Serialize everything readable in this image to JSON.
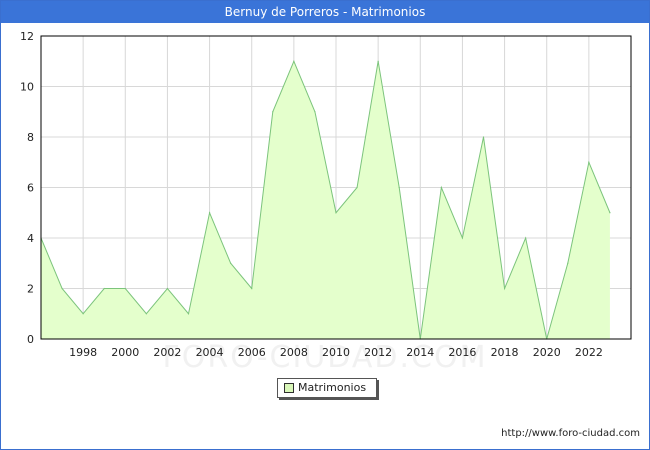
{
  "window": {
    "title": "Bernuy de Porreros - Matrimonios"
  },
  "watermark": "FORO-CIUDAD.COM",
  "source": "http://www.foro-ciudad.com",
  "colors": {
    "title_bar": "#3a74d8",
    "area_fill": "#e4ffcc",
    "line": "#7cc47c",
    "grid": "#d8d8d8",
    "swatch": "#d9f7b9"
  },
  "chart_data": {
    "type": "area",
    "title": "Bernuy de Porreros - Matrimonios",
    "xlabel": "",
    "ylabel": "",
    "ylim": [
      0,
      12
    ],
    "xlim": [
      1996,
      2024
    ],
    "grid": true,
    "legend_position": "bottom-center",
    "yticks": [
      "0",
      "2",
      "4",
      "6",
      "8",
      "10",
      "12"
    ],
    "xticks": [
      "1998",
      "2000",
      "2002",
      "2004",
      "2006",
      "2008",
      "2010",
      "2012",
      "2014",
      "2016",
      "2018",
      "2020",
      "2022"
    ],
    "x": [
      1996,
      1997,
      1998,
      1999,
      2000,
      2001,
      2002,
      2003,
      2004,
      2005,
      2006,
      2007,
      2008,
      2009,
      2010,
      2011,
      2012,
      2013,
      2014,
      2015,
      2016,
      2017,
      2018,
      2019,
      2020,
      2021,
      2022,
      2023
    ],
    "series": [
      {
        "name": "Matrimonios",
        "values": [
          4,
          2,
          1,
          2,
          2,
          1,
          2,
          1,
          5,
          3,
          2,
          9,
          11,
          9,
          5,
          6,
          11,
          6,
          0,
          6,
          4,
          8,
          2,
          4,
          0,
          3,
          7,
          5
        ]
      }
    ]
  }
}
